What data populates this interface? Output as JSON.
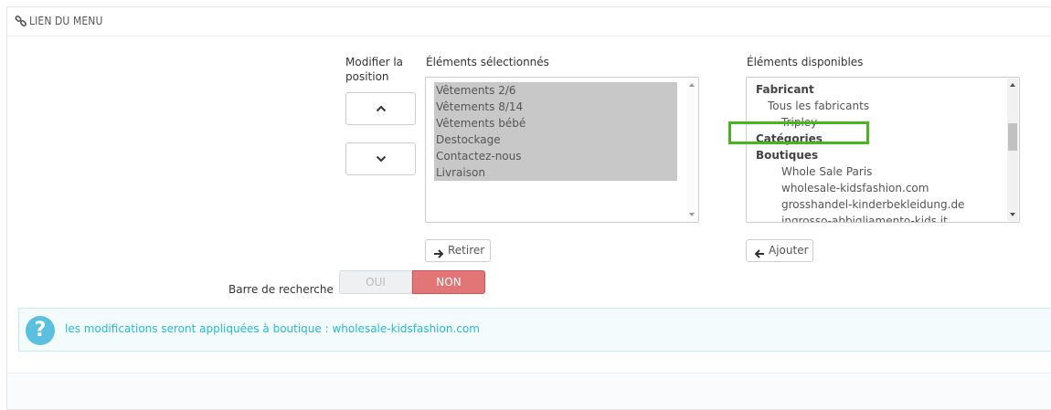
{
  "panel": {
    "title": "LIEN DU MENU",
    "title_icon": "link-icon"
  },
  "position": {
    "label": "Modifier la position",
    "up_icon": "chevron-up-icon",
    "down_icon": "chevron-down-icon"
  },
  "selected": {
    "label": "Éléments sélectionnés",
    "items": [
      "Vêtements 2/6",
      "Vêtements 8/14",
      "Vêtements bébé",
      "Destockage",
      "Contactez-nous",
      "Livraison"
    ],
    "remove_button": "Retirer",
    "remove_icon": "arrow-right-icon"
  },
  "available": {
    "label": "Éléments disponibles",
    "items": [
      {
        "text": "Fabricant",
        "group": true
      },
      {
        "text": "Tous les fabricants",
        "level": 1
      },
      {
        "text": "Tripley",
        "level": 2
      },
      {
        "text": "Catégories",
        "group": true
      },
      {
        "text": "Boutiques",
        "group": true
      },
      {
        "text": "Whole Sale Paris",
        "level": 2
      },
      {
        "text": "wholesale-kidsfashion.com",
        "level": 2
      },
      {
        "text": "grosshandel-kinderbekleidung.de",
        "level": 2
      },
      {
        "text": "ingrosso-abbigliamento-kids.it",
        "level": 2
      }
    ],
    "add_button": "Ajouter",
    "add_icon": "arrow-left-icon",
    "highlight_color": "#49b51c"
  },
  "search_bar": {
    "label": "Barre de recherche",
    "yes": "OUI",
    "no": "NON",
    "selected": "NON"
  },
  "alert": {
    "icon": "question-icon",
    "message": "les modifications seront appliquées à boutique : wholesale-kidsfashion.com"
  },
  "colors": {
    "switch_no": "#e27575",
    "info_text": "#25b9d7",
    "info_icon": "#5bc0de"
  }
}
